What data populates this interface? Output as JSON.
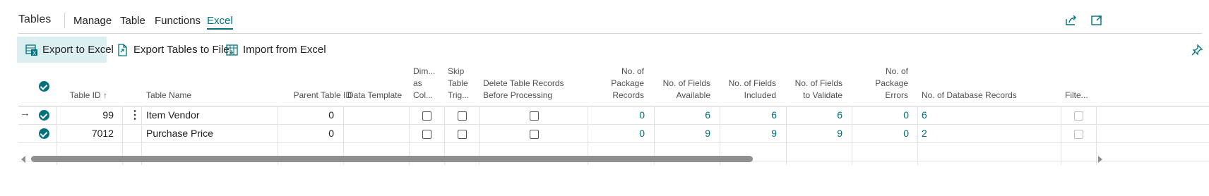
{
  "page": {
    "title": "Tables",
    "tabs": [
      "Manage",
      "Table",
      "Functions",
      "Excel"
    ],
    "active_tab": "Excel",
    "top_right_icons": [
      "share-icon",
      "expand-icon"
    ]
  },
  "actions": [
    {
      "label": "Export to Excel",
      "icon": "excel-export-icon",
      "active": true
    },
    {
      "label": "Export Tables to File",
      "icon": "export-file-icon",
      "active": false
    },
    {
      "label": "Import from Excel",
      "icon": "excel-import-icon",
      "active": false
    }
  ],
  "columns": {
    "table_id": "Table ID ↑",
    "table_name": "Table Name",
    "parent_table_id": "Parent Table ID",
    "data_template": "Data Template",
    "dim_as_col": [
      "Dim...",
      "as",
      "Col..."
    ],
    "skip_table_trig": [
      "Skip",
      "Table",
      "Trig..."
    ],
    "delete_records": [
      "Delete Table Records",
      "Before Processing"
    ],
    "package_records": [
      "No. of Package",
      "Records"
    ],
    "fields_available": [
      "No. of Fields",
      "Available"
    ],
    "fields_included": [
      "No. of Fields",
      "Included"
    ],
    "fields_validate": [
      "No. of Fields",
      "to Validate"
    ],
    "package_errors": [
      "No. of Package",
      "Errors"
    ],
    "database_records": "No. of Database Records",
    "filter": "Filte..."
  },
  "rows": [
    {
      "current": true,
      "table_id": "99",
      "table_name": "Item Vendor",
      "parent_table_id": "0",
      "package_records": "0",
      "fields_available": "6",
      "fields_included": "6",
      "fields_validate": "6",
      "package_errors": "0",
      "database_records": "6"
    },
    {
      "current": false,
      "table_id": "7012",
      "table_name": "Purchase Price",
      "parent_table_id": "0",
      "package_records": "0",
      "fields_available": "9",
      "fields_included": "9",
      "fields_validate": "9",
      "package_errors": "0",
      "database_records": "2"
    }
  ],
  "colors": {
    "accent": "#00707c",
    "action_active_bg": "#dbeef0"
  }
}
